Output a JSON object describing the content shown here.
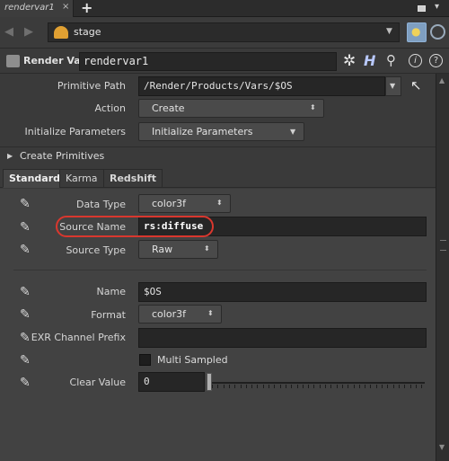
{
  "tab": {
    "title": "rendervar1",
    "close": "×",
    "add": "+",
    "menu": "▾"
  },
  "path": {
    "text": "stage"
  },
  "node": {
    "type_label": "Render Var",
    "name": "rendervar1",
    "help_label": "H",
    "info_label": "i",
    "question_label": "?"
  },
  "params": {
    "primitive_path": {
      "label": "Primitive Path",
      "value": "/Render/Products/Vars/$OS"
    },
    "action": {
      "label": "Action",
      "value": "Create"
    },
    "initialize": {
      "label": "Initialize Parameters",
      "value": "Initialize Parameters"
    },
    "create_primitives": {
      "label": "Create Primitives"
    }
  },
  "tabs": [
    {
      "label": "Standard"
    },
    {
      "label": "Karma"
    },
    {
      "label": "Redshift"
    }
  ],
  "standard": {
    "data_type": {
      "label": "Data Type",
      "value": "color3f"
    },
    "source_name": {
      "label": "Source Name",
      "value": "rs:diffuse"
    },
    "source_type": {
      "label": "Source Type",
      "value": "Raw"
    },
    "name": {
      "label": "Name",
      "value": "$OS"
    },
    "format": {
      "label": "Format",
      "value": "color3f"
    },
    "exr_prefix": {
      "label": "EXR Channel Prefix",
      "value": ""
    },
    "multi_sampled": {
      "label": "Multi Sampled",
      "checked": false
    },
    "clear_value": {
      "label": "Clear Value",
      "value": "0",
      "slider_fraction": 0.0
    }
  },
  "icons": {
    "back": "◀",
    "forward": "▶",
    "gear": "✲",
    "search": "⚲",
    "pencil": "✎",
    "updown": "⬍",
    "down": "▼",
    "expand": "▶",
    "pointer": "↖"
  },
  "colors": {
    "highlight": "#d9372e",
    "pin_active": "#7f9fc1",
    "stage_icon": "#e0a032"
  }
}
